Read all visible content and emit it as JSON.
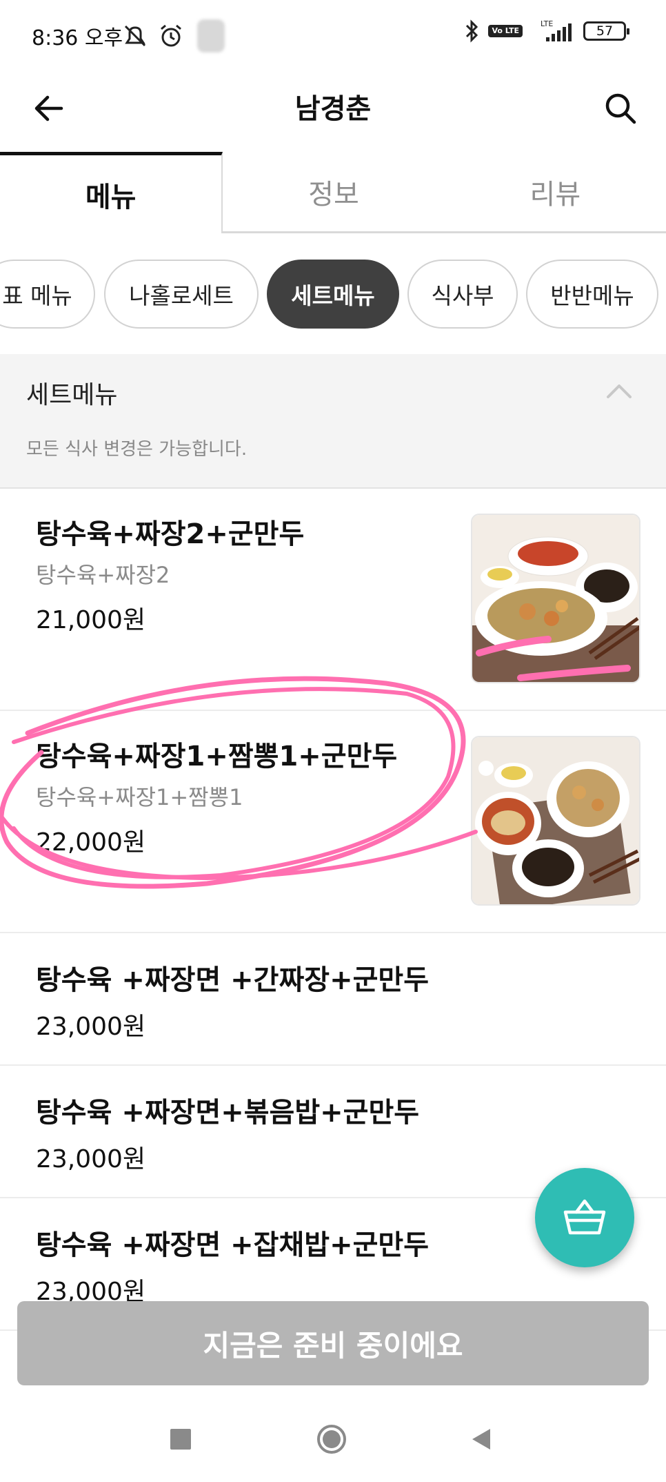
{
  "status_bar": {
    "time": "8:36 오후",
    "battery": "57",
    "network": "LTE",
    "volte": "Vo LTE"
  },
  "header": {
    "title": "남경춘"
  },
  "tabs": [
    {
      "label": "메뉴",
      "active": true
    },
    {
      "label": "정보",
      "active": false
    },
    {
      "label": "리뷰",
      "active": false
    }
  ],
  "categories": [
    {
      "label": "대표 메뉴",
      "visible_text": "표 메뉴",
      "active": false
    },
    {
      "label": "나홀로세트",
      "active": false
    },
    {
      "label": "세트메뉴",
      "active": true
    },
    {
      "label": "식사부",
      "active": false
    },
    {
      "label": "반반메뉴",
      "active": false
    }
  ],
  "section": {
    "title": "세트메뉴",
    "description": "모든 식사 변경은 가능합니다."
  },
  "menu_items": [
    {
      "name": "탕수육+짜장2+군만두",
      "description": "탕수육+짜장2",
      "price": "21,000원",
      "has_image": true
    },
    {
      "name": "탕수육+짜장1+짬뽕1+군만두",
      "description": "탕수육+짜장1+짬뽕1",
      "price": "22,000원",
      "has_image": true
    },
    {
      "name": "탕수육 +짜장면 +간짜장+군만두",
      "price": "23,000원",
      "has_image": false
    },
    {
      "name": "탕수육 +짜장면+볶음밥+군만두",
      "price": "23,000원",
      "has_image": false
    },
    {
      "name": "탕수육 +짜장면 +잡채밥+군만두",
      "price": "23,000원",
      "has_image": false
    }
  ],
  "order_button": {
    "label": "지금은 준비 중이에요"
  },
  "colors": {
    "accent": "#2fbdb4",
    "chip_active": "#404040",
    "disabled_button": "#b5b5b5",
    "annotation": "#ff6fb0"
  },
  "icons": {
    "back": "arrow-left-icon",
    "search": "search-icon",
    "collapse": "chevron-up-icon",
    "cart": "basket-icon"
  }
}
